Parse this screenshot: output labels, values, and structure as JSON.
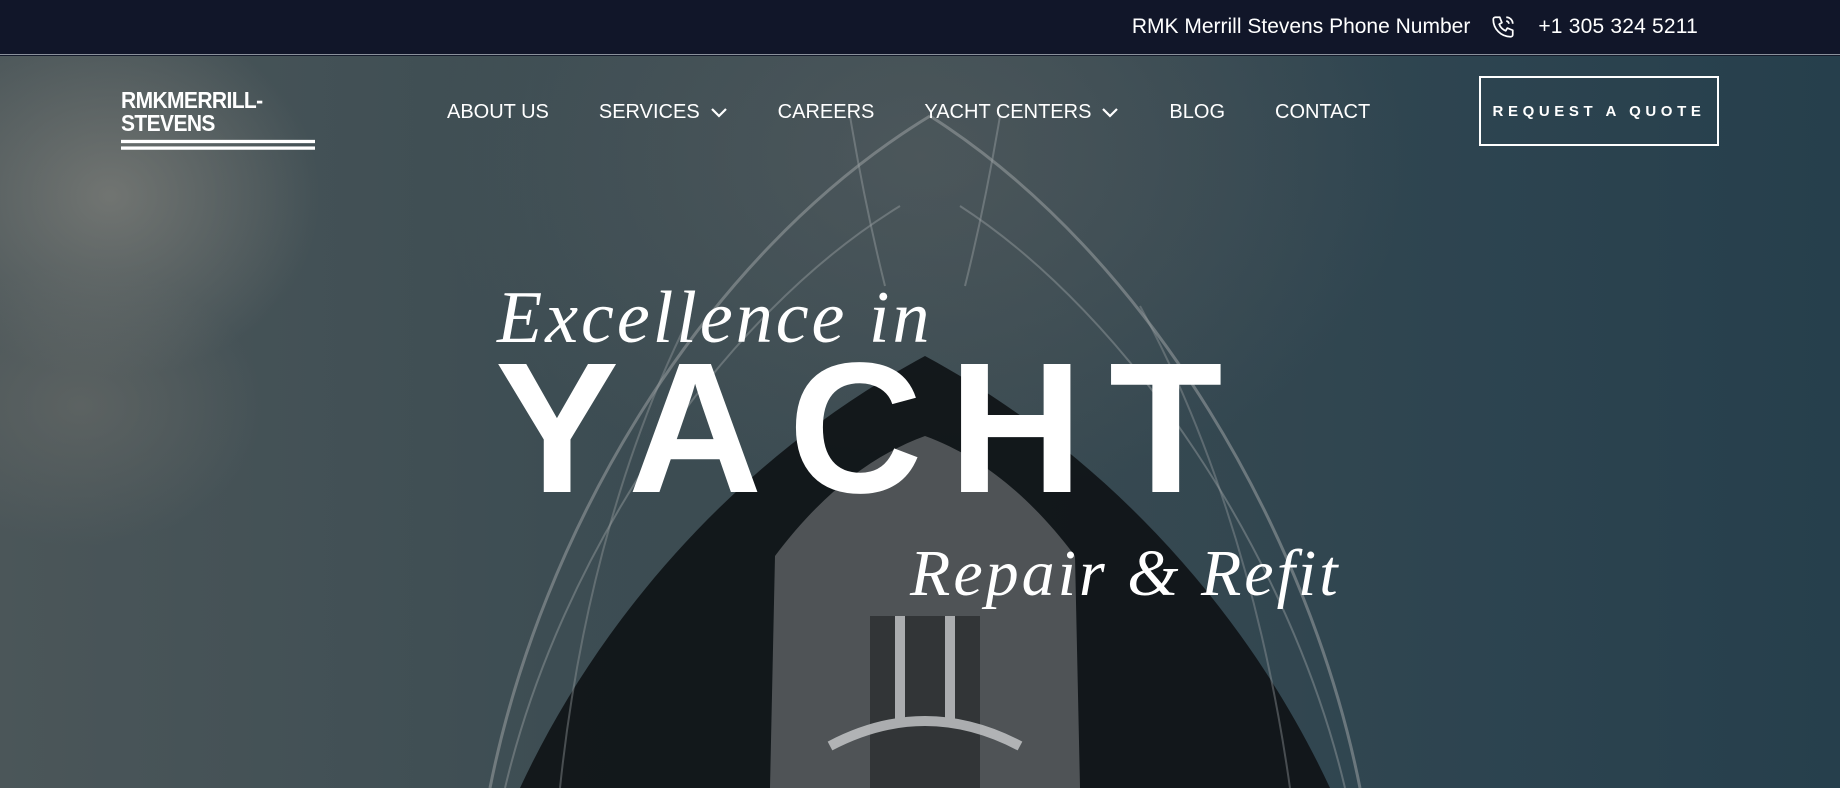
{
  "topbar": {
    "phone_label": "RMK Merrill Stevens Phone Number",
    "phone_icon": "phone-icon",
    "phone_number": "+1 305 324 5211"
  },
  "header": {
    "logo_text": "RMKMERRILL-STEVENS",
    "nav": [
      {
        "label": "ABOUT US",
        "has_dropdown": false
      },
      {
        "label": "SERVICES",
        "has_dropdown": true
      },
      {
        "label": "CAREERS",
        "has_dropdown": false
      },
      {
        "label": "YACHT CENTERS",
        "has_dropdown": true
      },
      {
        "label": "BLOG",
        "has_dropdown": false
      },
      {
        "label": "CONTACT",
        "has_dropdown": false
      }
    ],
    "cta_label": "REQUEST A QUOTE"
  },
  "hero": {
    "line1": "Excellence in",
    "line2": "YACHT",
    "line3": "Repair & Refit"
  },
  "colors": {
    "topbar_bg": "#111629",
    "hero_overlay": "#2f444e",
    "text": "#ffffff"
  }
}
